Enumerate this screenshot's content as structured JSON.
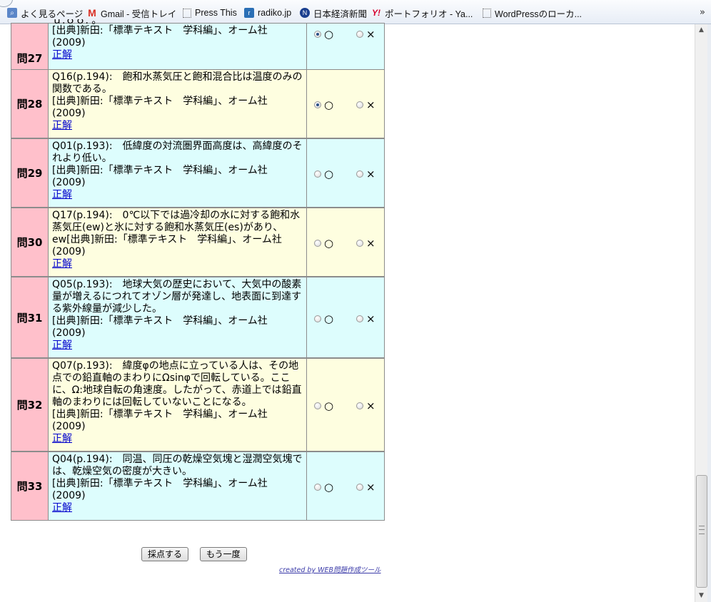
{
  "bookmarks": [
    {
      "label": "よく見るページ",
      "icon": "most-visited-icon"
    },
    {
      "label": "Gmail - 受信トレイ",
      "icon": "gmail-icon"
    },
    {
      "label": "Press This",
      "icon": "page-icon"
    },
    {
      "label": "radiko.jp",
      "icon": "radiko-icon"
    },
    {
      "label": "日本経済新聞",
      "icon": "nikkei-icon"
    },
    {
      "label": "ポートフォリオ - Ya...",
      "icon": "yahoo-icon"
    },
    {
      "label": "WordPressのローカ...",
      "icon": "page-icon"
    }
  ],
  "more_bookmarks": "»",
  "questions": [
    {
      "num": "問27",
      "lines": [],
      "citation": "[出典]新田:「標準テキスト　学科編」、オーム社 (2009)",
      "answer_link": "正解",
      "selected": "o",
      "truncated_top": true,
      "color": "cyan"
    },
    {
      "num": "問28",
      "lines": [
        "Q16(p.194):　飽和水蒸気圧と飽和混合比は温度のみの関数である。"
      ],
      "citation": "[出典]新田:「標準テキスト　学科編」、オーム社 (2009)",
      "answer_link": "正解",
      "selected": "o",
      "color": "yellow"
    },
    {
      "num": "問29",
      "lines": [
        "Q01(p.193):　低緯度の対流圏界面高度は、高緯度のそれより低い。"
      ],
      "citation": "[出典]新田:「標準テキスト　学科編」、オーム社 (2009)",
      "answer_link": "正解",
      "selected": null,
      "color": "cyan"
    },
    {
      "num": "問30",
      "lines": [
        "Q17(p.194):　0℃以下では過冷却の水に対する飽和水蒸気圧(ew)と氷に対する飽和水蒸気圧(es)があり、ew[出典]新田:「標準テキスト　学科編」、オーム社(2009)"
      ],
      "citation": "",
      "answer_link": "正解",
      "selected": null,
      "color": "yellow"
    },
    {
      "num": "問31",
      "lines": [
        "Q05(p.193):　地球大気の歴史において、大気中の酸素量が増えるにつれてオゾン層が発達し、地表面に到達する紫外線量が減少した。"
      ],
      "citation": "[出典]新田:「標準テキスト　学科編」、オーム社 (2009)",
      "answer_link": "正解",
      "selected": null,
      "color": "cyan"
    },
    {
      "num": "問32",
      "lines": [
        "Q07(p.193):　緯度φの地点に立っている人は、その地点での鉛直軸のまわりにΩsinφで回転している。ここに、Ω:地球自転の角速度。したがって、赤道上では鉛直軸のまわりには回転していないことになる。"
      ],
      "citation": "[出典]新田:「標準テキスト　学科編」、オーム社 (2009)",
      "answer_link": "正解",
      "selected": null,
      "color": "yellow"
    },
    {
      "num": "問33",
      "lines": [
        "Q04(p.194):　同温、同圧の乾燥空気塊と湿潤空気塊では、乾燥空気の密度が大きい。"
      ],
      "citation": "[出典]新田:「標準テキスト　学科編」、オーム社 (2009)",
      "answer_link": "正解",
      "selected": null,
      "color": "cyan"
    }
  ],
  "option_labels": {
    "correct": "○",
    "wrong": "×"
  },
  "buttons": {
    "grade": "採点する",
    "retry": "もう一度"
  },
  "footer": {
    "credit": "created by WEB問題作成ツール"
  },
  "colors": {
    "number_cell": "#ffc0cb",
    "row_cyan": "#ddfdfd",
    "row_yellow": "#fefee0",
    "link": "#0000cc"
  }
}
